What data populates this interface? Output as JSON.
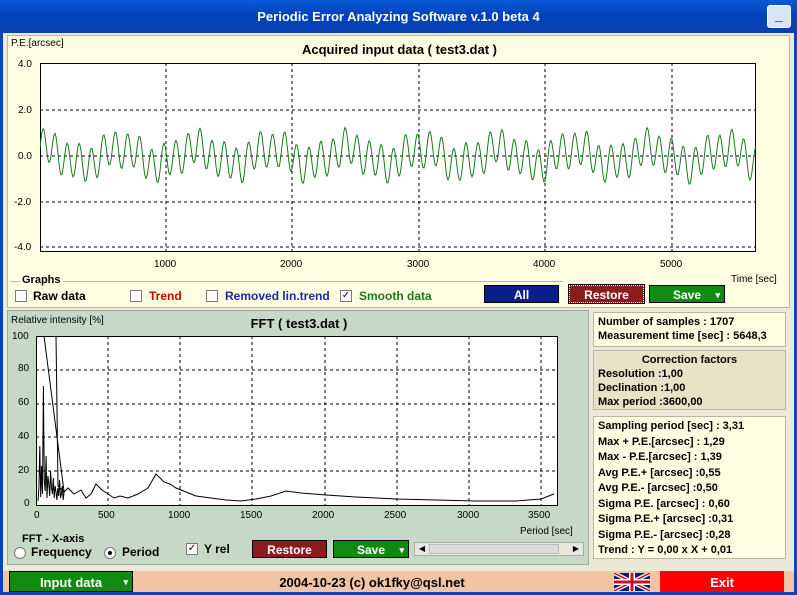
{
  "window": {
    "title": "Periodic Error Analyzing Software v.1.0 beta 4",
    "min_label": "_"
  },
  "top_chart": {
    "ylabel": "P.E.[arcsec]",
    "title": "Acquired input data ( test3.dat )",
    "xlabel": "Time [sec]",
    "yticks": [
      "4.0",
      "2.0",
      "0.0",
      "-2.0",
      "-4.0"
    ],
    "xticks": [
      "1000",
      "2000",
      "3000",
      "4000",
      "5000"
    ]
  },
  "graphs": {
    "legend": "Graphs",
    "raw": "Raw data",
    "trend": "Trend",
    "removed": "Removed lin.trend",
    "smooth": "Smooth data",
    "smooth_check": "✓",
    "all_btn": "All",
    "restore_btn": "Restore",
    "save_btn": "Save",
    "dropdown": "▾"
  },
  "fft_chart": {
    "ylabel": "Relative intensity [%]",
    "title": "FFT ( test3.dat )",
    "xlabel": "Period [sec]",
    "yticks": [
      "100",
      "80",
      "60",
      "40",
      "20",
      "0"
    ],
    "xticks": [
      "0",
      "500",
      "1000",
      "1500",
      "2000",
      "2500",
      "3000",
      "3500"
    ]
  },
  "fft_controls": {
    "axis_label": "FFT - X-axis",
    "frequency": "Frequency",
    "period": "Period",
    "yrel": "Y rel",
    "yrel_check": "✓",
    "restore_btn": "Restore",
    "save_btn": "Save",
    "dropdown": "▾",
    "scroll_left": "◀",
    "scroll_right": "▶"
  },
  "samples_box": {
    "line1": "Number of samples : 1707",
    "line2": "Measurement time [sec] : 5648,3"
  },
  "correction": {
    "title": "Correction factors",
    "resolution": "Resolution :1,00",
    "declination": "Declination :1,00",
    "max_period": "Max period :3600,00"
  },
  "stats": [
    "Sampling period [sec] : 3,31",
    "Max + P.E.[arcsec] : 1,29",
    "Max - P.E.[arcsec] : 1,39",
    "Avg P.E.+ [arcsec] :0,55",
    "Avg P.E.- [arcsec] :0,50",
    "Sigma P.E. [arcsec] : 0,60",
    "Sigma P.E.+ [arcsec] :0,31",
    "Sigma P.E.- [arcsec] :0,28",
    "Trend : Y = 0,00 x X + 0,01"
  ],
  "statusbar": {
    "input_btn": "Input data",
    "dropdown": "▾",
    "center": "2004-10-23 (c) ok1fky@qsl.net",
    "exit_btn": "Exit"
  },
  "colors": {
    "signal": "#1a7a1a",
    "trend": "#cc0000",
    "removed": "#1a2aa0",
    "all_btn": "#0a1e8c",
    "restore_btn": "#8c1c1c",
    "save_btn": "#118a11",
    "exit_btn": "#ff0000"
  }
}
